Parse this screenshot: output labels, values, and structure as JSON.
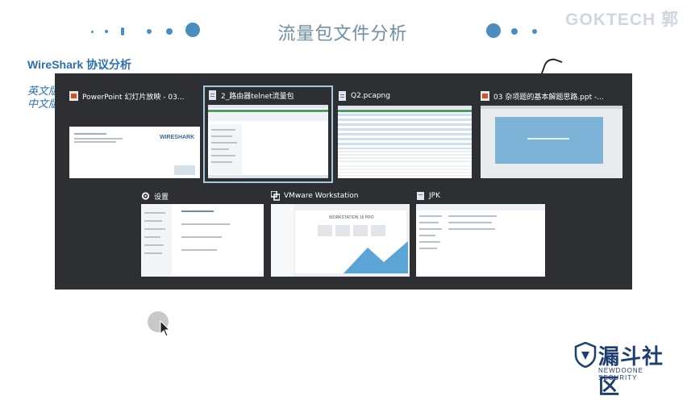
{
  "slide": {
    "title": "流量包文件分析",
    "brand": "GOKTECH 郭",
    "heading": "WireShark 协议分析",
    "line1": "英文版",
    "line2": "中文版"
  },
  "switcher": {
    "windows": [
      {
        "title": "PowerPoint 幻灯片放映  -  03...",
        "icon": "powerpoint-icon",
        "selected": false,
        "thumb_label": "WIRESHARK"
      },
      {
        "title": "2_路由器telnet流量包",
        "icon": "wireshark-doc-icon",
        "selected": true
      },
      {
        "title": "Q2.pcapng",
        "icon": "wireshark-doc-icon",
        "selected": false
      },
      {
        "title": "03 杂项题的基本解题思路.ppt  -...",
        "icon": "powerpoint-icon",
        "selected": false
      },
      {
        "title": "设置",
        "icon": "gear-icon",
        "selected": false
      },
      {
        "title": "VMware Workstation",
        "icon": "vmware-icon",
        "selected": false,
        "thumb_label": "WORKSTATION 15 PRO"
      },
      {
        "title": "JPK",
        "icon": "folder-icon",
        "selected": false
      }
    ]
  },
  "logo": {
    "name": "漏斗社区",
    "tagline": "NEWDOONE SECURITY"
  },
  "colors": {
    "accent_blue": "#4a8ec0",
    "overlay_bg": "#2d2f33",
    "title_color": "#6f8fa6",
    "logo_color": "#1d3e73"
  }
}
